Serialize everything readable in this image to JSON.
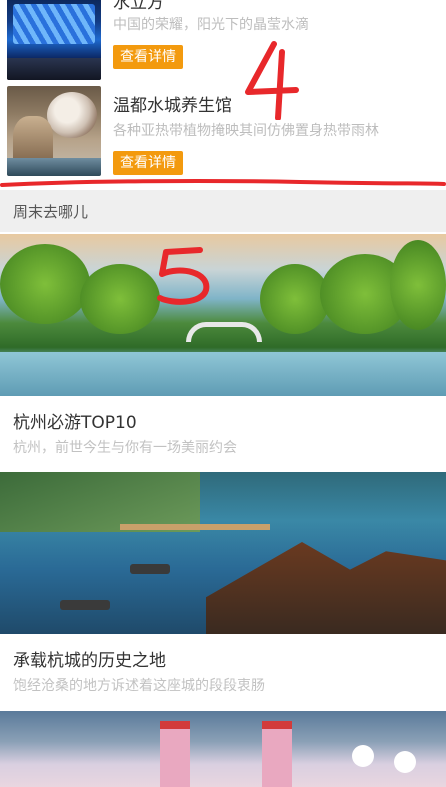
{
  "attractions": [
    {
      "title": "水立方",
      "desc": "中国的荣耀，阳光下的晶莹水滴",
      "button": "查看详情"
    },
    {
      "title": "温都水城养生馆",
      "desc": "各种亚热带植物掩映其间仿佛置身热带雨林",
      "button": "查看详情"
    }
  ],
  "annotations": {
    "mark_4": "4",
    "mark_5": "5",
    "color": "#e8282b"
  },
  "weekend_section": {
    "header": "周末去哪儿",
    "cards": [
      {
        "title": "杭州必游TOP10",
        "desc": "杭州，前世今生与你有一场美丽约会"
      },
      {
        "title": "承载杭城的历史之地",
        "desc": "饱经沧桑的地方诉述着这座城的段段衷肠"
      }
    ]
  },
  "colors": {
    "button_bg": "#f39a0e",
    "section_header_bg": "#efefef"
  }
}
